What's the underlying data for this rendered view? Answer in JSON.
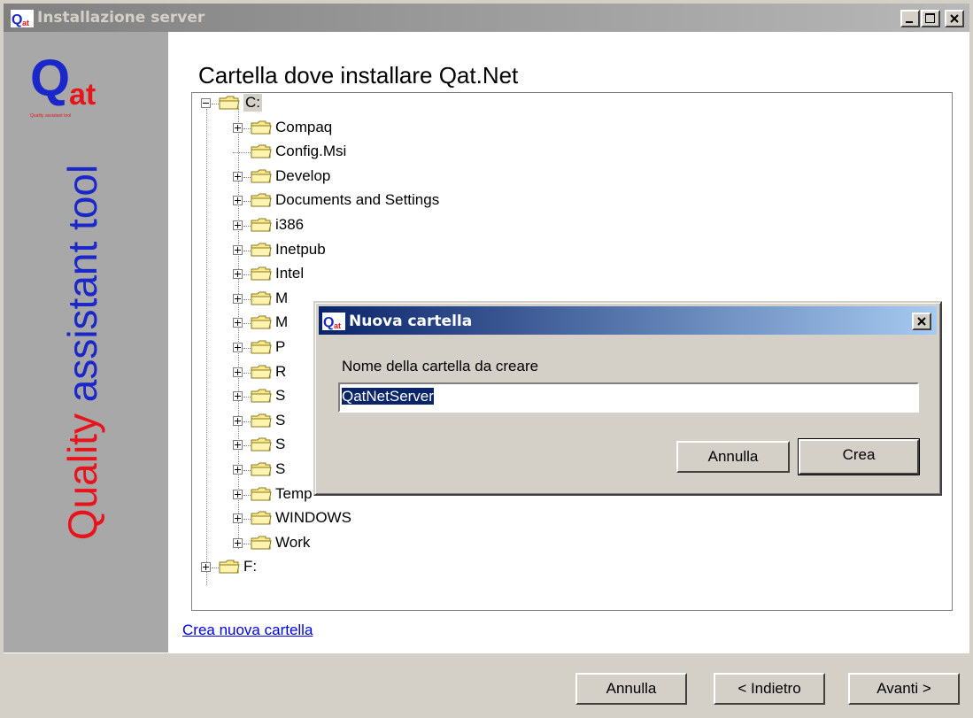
{
  "window": {
    "title": "Installazione server",
    "minimize_label": "_",
    "maximize_label": "□",
    "close_label": "x"
  },
  "sidebar": {
    "logo_text": "Qat",
    "logo_tagline": "Quality assistant tool",
    "vertical_word_1": "Quality",
    "vertical_word_2": "assistant tool"
  },
  "main": {
    "heading": "Cartella dove installare Qat.Net",
    "create_folder_link": "Crea nuova cartella"
  },
  "tree": {
    "root_c": "C:",
    "items": [
      {
        "label": "Compaq"
      },
      {
        "label": "Config.Msi"
      },
      {
        "label": "Develop"
      },
      {
        "label": "Documents and Settings"
      },
      {
        "label": "i386"
      },
      {
        "label": "Inetpub"
      },
      {
        "label": "Intel"
      },
      {
        "label": "M"
      },
      {
        "label": "M"
      },
      {
        "label": "P"
      },
      {
        "label": "R"
      },
      {
        "label": "S"
      },
      {
        "label": "S"
      },
      {
        "label": "S"
      },
      {
        "label": "S"
      },
      {
        "label": "Temp"
      },
      {
        "label": "WINDOWS"
      },
      {
        "label": "Work"
      }
    ],
    "root_f": "F:"
  },
  "footer": {
    "cancel": "Annulla",
    "back": "< Indietro",
    "next": "Avanti >"
  },
  "dialog": {
    "title": "Nuova cartella",
    "prompt": "Nome della cartella da creare",
    "input_value": "QatNetServer",
    "cancel": "Annulla",
    "create": "Crea"
  },
  "colors": {
    "title_active": "#0a246a",
    "title_inactive": "#808080",
    "sidebar_bg": "#a8a8a8",
    "qat_red": "#e8141c",
    "qat_blue": "#1a27c9"
  }
}
